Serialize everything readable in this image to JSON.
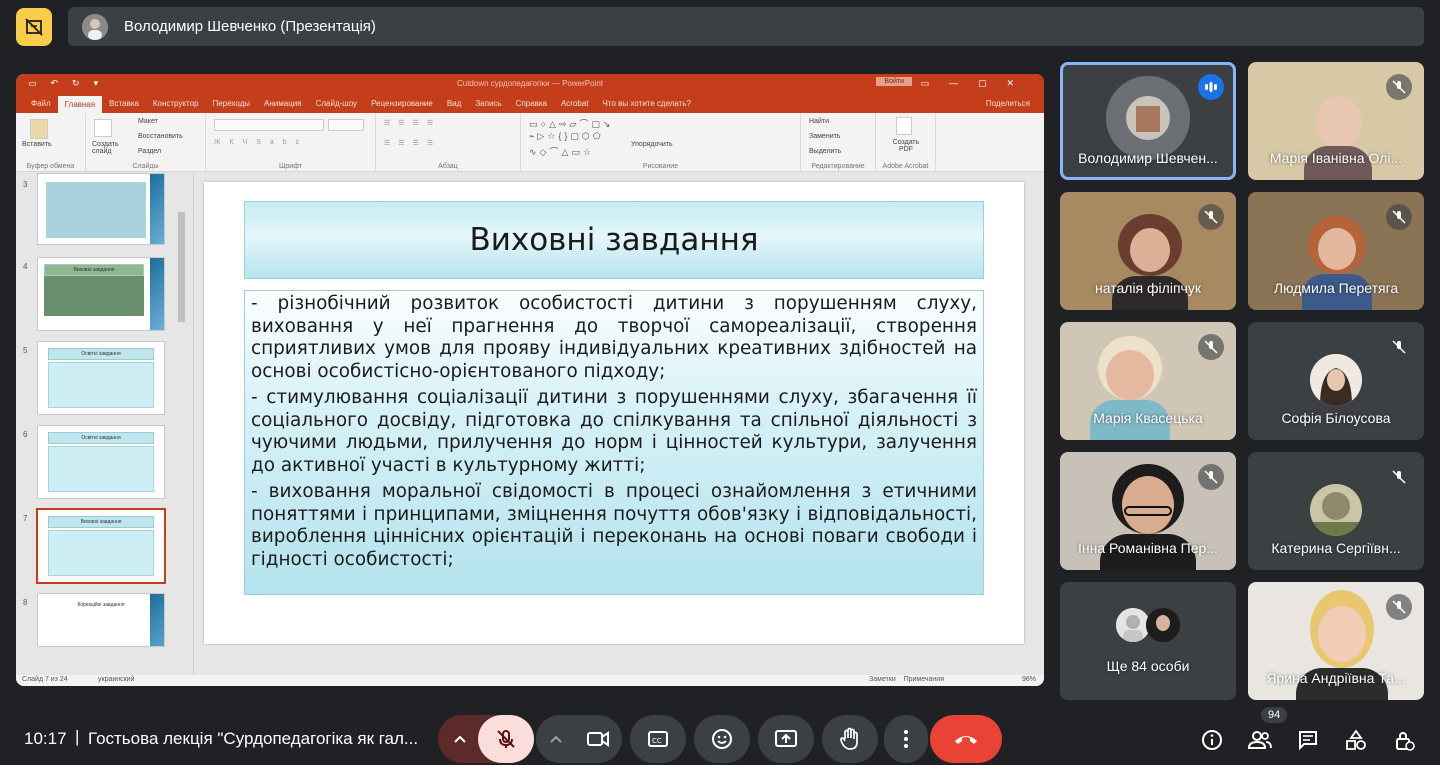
{
  "meeting": {
    "time": "10:17",
    "separator": "|",
    "title": "Гостьова лекція \"Сурдопедагогіка як гал...",
    "presenter_label": "Володимир Шевченко (Презентація)",
    "participant_count": "94"
  },
  "powerpoint": {
    "window_title": "Сutdown сурдопедагогіки — PowerPoint",
    "login_button": "Войти",
    "menu": [
      "Файл",
      "Главная",
      "Вставка",
      "Конструктор",
      "Переходы",
      "Анимация",
      "Слайд-шоу",
      "Рецензирование",
      "Вид",
      "Запись",
      "Справка",
      "Acrobat",
      "Что вы хотите сделать?"
    ],
    "share": "Поделиться",
    "ribbon": {
      "paste": "Вставить",
      "clipboard": "Буфер обмена",
      "new_slide": "Создать слайд",
      "layout": "Макет",
      "reset": "Восстановить",
      "section": "Раздел",
      "slides": "Слайды",
      "font": "Шрифт",
      "paragraph": "Абзац",
      "arrange": "Упорядочить",
      "drawing": "Рисование",
      "find": "Найти",
      "replace": "Заменить",
      "select": "Выделить",
      "editing": "Редактирование",
      "create_pdf": "Создать PDF",
      "adobe": "Adobe Acrobat"
    },
    "status": {
      "slide": "Слайд 7 из 24",
      "language": "украинский",
      "notes": "Заметки",
      "comments": "Примечания",
      "zoom": "96%"
    },
    "thumbnails": [
      {
        "num": "3",
        "title": ""
      },
      {
        "num": "4",
        "title": "Виховні завдання"
      },
      {
        "num": "5",
        "title": "Освітні завдання"
      },
      {
        "num": "6",
        "title": "Освітні завдання"
      },
      {
        "num": "7",
        "title": "Виховні завдання"
      },
      {
        "num": "8",
        "title": "Корекційні завдання"
      }
    ],
    "slide": {
      "title": "Виховні завдання",
      "bullets": [
        "-        різнобічний розвиток особистості дитини з порушенням слуху, виховання у неї прагнення до творчої самореалізації, створення сприятливих умов для прояву індивідуальних креативних здібностей на основі особистісно-орієнтованого підходу;",
        "-        стимулювання соціалізації дитини з порушеннями слуху, збагачення її соціального досвіду, підготовка до спілкування та спільної діяльності з чуючими людьми, прилучення до норм і цінностей культури, залучення до активної участі в культурному житті;",
        "-        виховання моральної свідомості в процесі ознайомлення з етичними поняттями і принципами, зміцнення почуття обов'язку і відповідальності, вироблення ціннісних орієнтацій і переконань на основі поваги свободи і гідності особистості;"
      ]
    }
  },
  "participants": [
    {
      "name": "Володимир Шевчен...",
      "speaking": true
    },
    {
      "name": "Марія Іванівна Олі...",
      "muted": true
    },
    {
      "name": "наталія філіпчук",
      "muted": true
    },
    {
      "name": "Людмила Перетяга",
      "muted": true
    },
    {
      "name": "Марія Квасецька",
      "muted": true
    },
    {
      "name": "Софія Білоусова",
      "muted": true
    },
    {
      "name": "Інна Романівна Пер...",
      "muted": true
    },
    {
      "name": "Катерина Сергіївн...",
      "muted": true
    },
    {
      "name": "Ще 84 особи"
    },
    {
      "name": "Ярина Андріївна Та...",
      "muted": true
    }
  ],
  "colors": {
    "background": "#202124",
    "tile": "#3c4043",
    "accent_yellow": "#f9cd4a",
    "hangup": "#ea4335",
    "mic_muted": "#f9dedc",
    "active_outline": "#8ab4f8",
    "powerpoint_red": "#c43e1c"
  },
  "icons": [
    "pin-icon",
    "chevron-up-icon",
    "mic-off-icon",
    "camera-icon",
    "captions-icon",
    "emoji-icon",
    "present-icon",
    "raise-hand-icon",
    "more-vert-icon",
    "hangup-icon",
    "info-icon",
    "people-icon",
    "chat-icon",
    "activities-icon",
    "host-controls-icon"
  ]
}
